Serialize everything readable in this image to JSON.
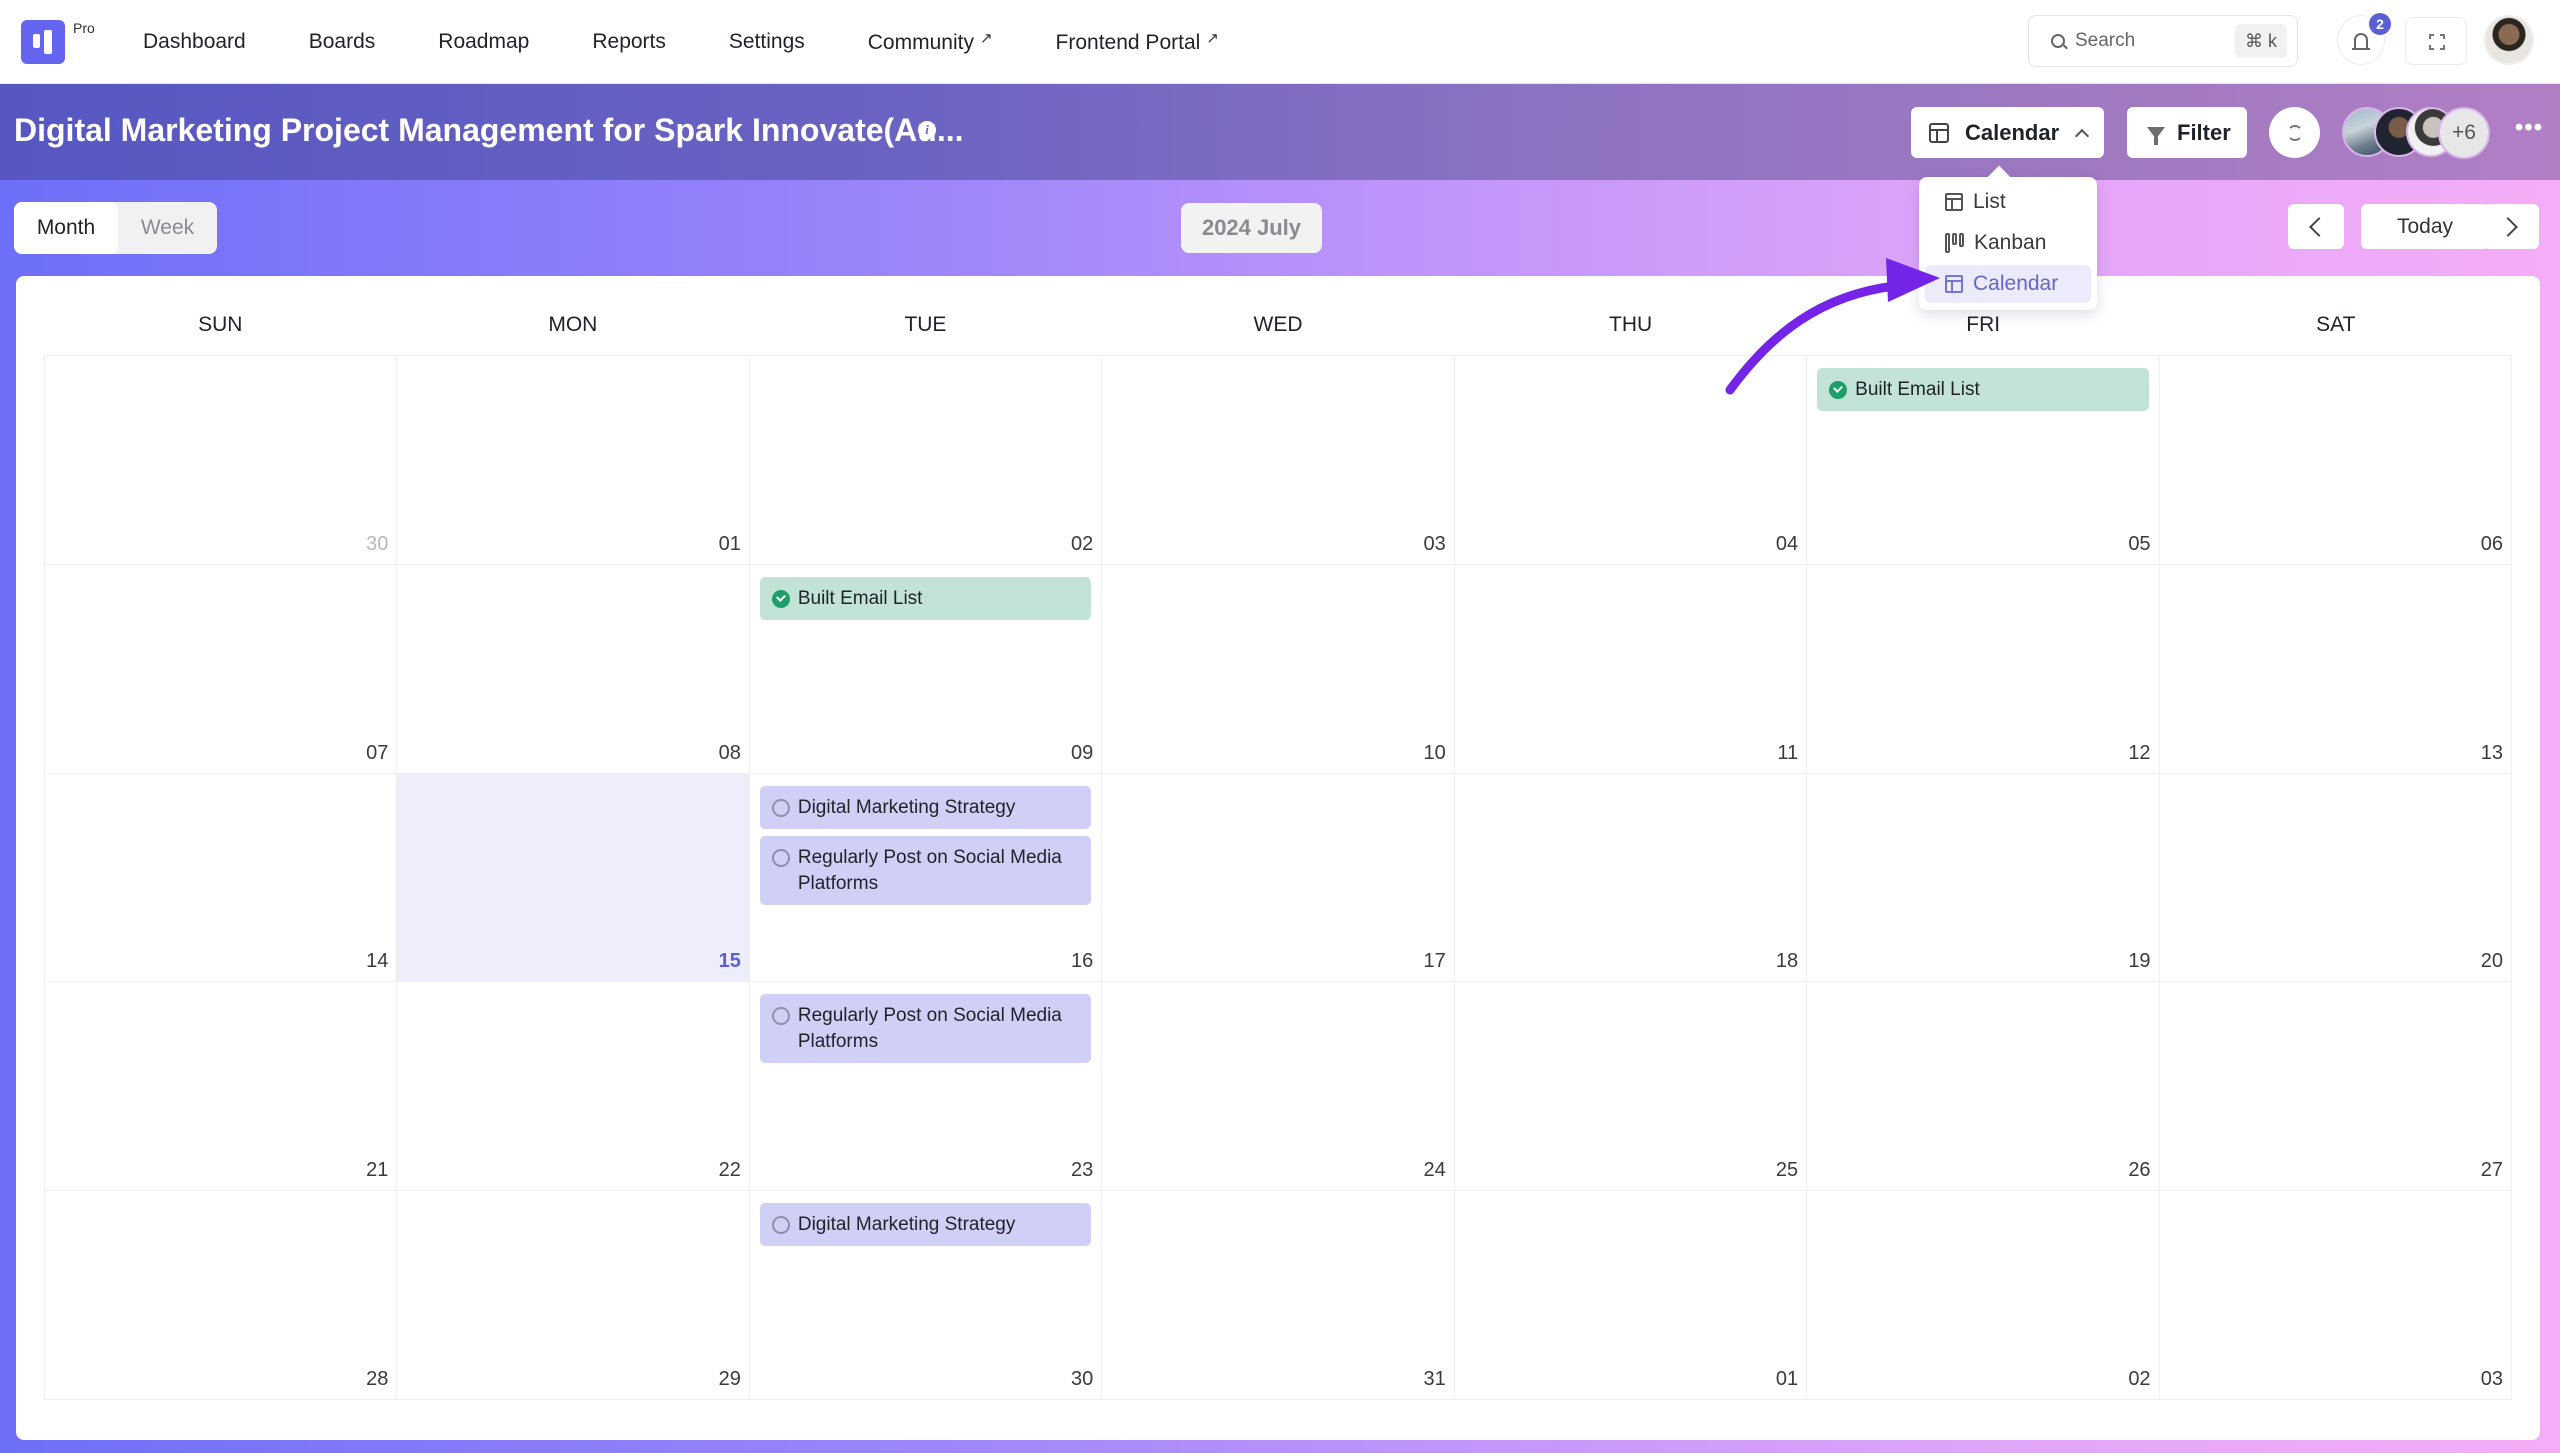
{
  "app": {
    "logo_badge": "Pro",
    "brand_color": "#6466f1"
  },
  "nav": {
    "items": [
      {
        "label": "Dashboard",
        "external": false
      },
      {
        "label": "Boards",
        "external": false
      },
      {
        "label": "Roadmap",
        "external": false
      },
      {
        "label": "Reports",
        "external": false
      },
      {
        "label": "Settings",
        "external": false
      },
      {
        "label": "Community",
        "external": true
      },
      {
        "label": "Frontend Portal",
        "external": true
      }
    ],
    "external_glyph": "↗",
    "search": {
      "placeholder": "Search",
      "shortcut": "⌘ k"
    },
    "notifications": {
      "count": "2",
      "icon": "bell-icon"
    },
    "fullscreen_icon": "fullscreen-icon",
    "user_avatar": "avatar"
  },
  "header": {
    "title": "Digital Marketing Project Management for Spark Innovate(Au...",
    "info_glyph": "i",
    "view_selector": {
      "label": "Calendar",
      "icon": "layout-icon"
    },
    "filter_label": "Filter",
    "refresh_icon": "refresh-icon",
    "members": {
      "visible_count": 3,
      "more_label": "+6"
    },
    "more_glyph": "•••"
  },
  "view_menu": {
    "options": [
      {
        "label": "List",
        "icon": "layout-icon",
        "selected": false
      },
      {
        "label": "Kanban",
        "icon": "kanban-icon",
        "selected": false
      },
      {
        "label": "Calendar",
        "icon": "layout-icon",
        "selected": true
      }
    ]
  },
  "toolbar": {
    "modes": [
      {
        "label": "Month",
        "active": true
      },
      {
        "label": "Week",
        "active": false
      }
    ],
    "current_period": "2024 July",
    "today_label": "Today",
    "prev_glyph": "‹",
    "next_glyph": "›"
  },
  "calendar": {
    "weekdays": [
      "SUN",
      "MON",
      "TUE",
      "WED",
      "THU",
      "FRI",
      "SAT"
    ],
    "weeks": [
      [
        {
          "day": "30",
          "other_month": true,
          "events": []
        },
        {
          "day": "01",
          "events": []
        },
        {
          "day": "02",
          "events": []
        },
        {
          "day": "03",
          "events": []
        },
        {
          "day": "04",
          "events": []
        },
        {
          "day": "05",
          "events": [
            {
              "title": "Built Email List",
              "status": "done"
            }
          ]
        },
        {
          "day": "06",
          "events": []
        }
      ],
      [
        {
          "day": "07",
          "events": []
        },
        {
          "day": "08",
          "events": []
        },
        {
          "day": "09",
          "events": [
            {
              "title": "Built Email List",
              "status": "done"
            }
          ]
        },
        {
          "day": "10",
          "events": []
        },
        {
          "day": "11",
          "events": []
        },
        {
          "day": "12",
          "events": []
        },
        {
          "day": "13",
          "events": []
        }
      ],
      [
        {
          "day": "14",
          "events": []
        },
        {
          "day": "15",
          "today": true,
          "events": []
        },
        {
          "day": "16",
          "events": [
            {
              "title": "Digital Marketing Strategy",
              "status": "todo"
            },
            {
              "title": "Regularly Post on Social Media Platforms",
              "status": "todo"
            }
          ]
        },
        {
          "day": "17",
          "events": []
        },
        {
          "day": "18",
          "events": []
        },
        {
          "day": "19",
          "events": []
        },
        {
          "day": "20",
          "events": []
        }
      ],
      [
        {
          "day": "21",
          "events": []
        },
        {
          "day": "22",
          "events": []
        },
        {
          "day": "23",
          "events": [
            {
              "title": "Regularly Post on Social Media Platforms",
              "status": "todo"
            }
          ]
        },
        {
          "day": "24",
          "events": []
        },
        {
          "day": "25",
          "events": []
        },
        {
          "day": "26",
          "events": []
        },
        {
          "day": "27",
          "events": []
        }
      ],
      [
        {
          "day": "28",
          "events": []
        },
        {
          "day": "29",
          "events": []
        },
        {
          "day": "30",
          "events": [
            {
              "title": "Digital Marketing Strategy",
              "status": "todo"
            }
          ]
        },
        {
          "day": "31",
          "events": []
        },
        {
          "day": "01",
          "events": []
        },
        {
          "day": "02",
          "events": []
        },
        {
          "day": "03",
          "events": []
        }
      ]
    ]
  },
  "colors": {
    "done_event_bg": "#c2e3d6",
    "done_check": "#1e9e6b",
    "todo_event_bg": "#d0d0f6",
    "today_bg": "#eeeefb",
    "today_text": "#5b5fd6",
    "annotation_arrow": "#7424e6"
  }
}
